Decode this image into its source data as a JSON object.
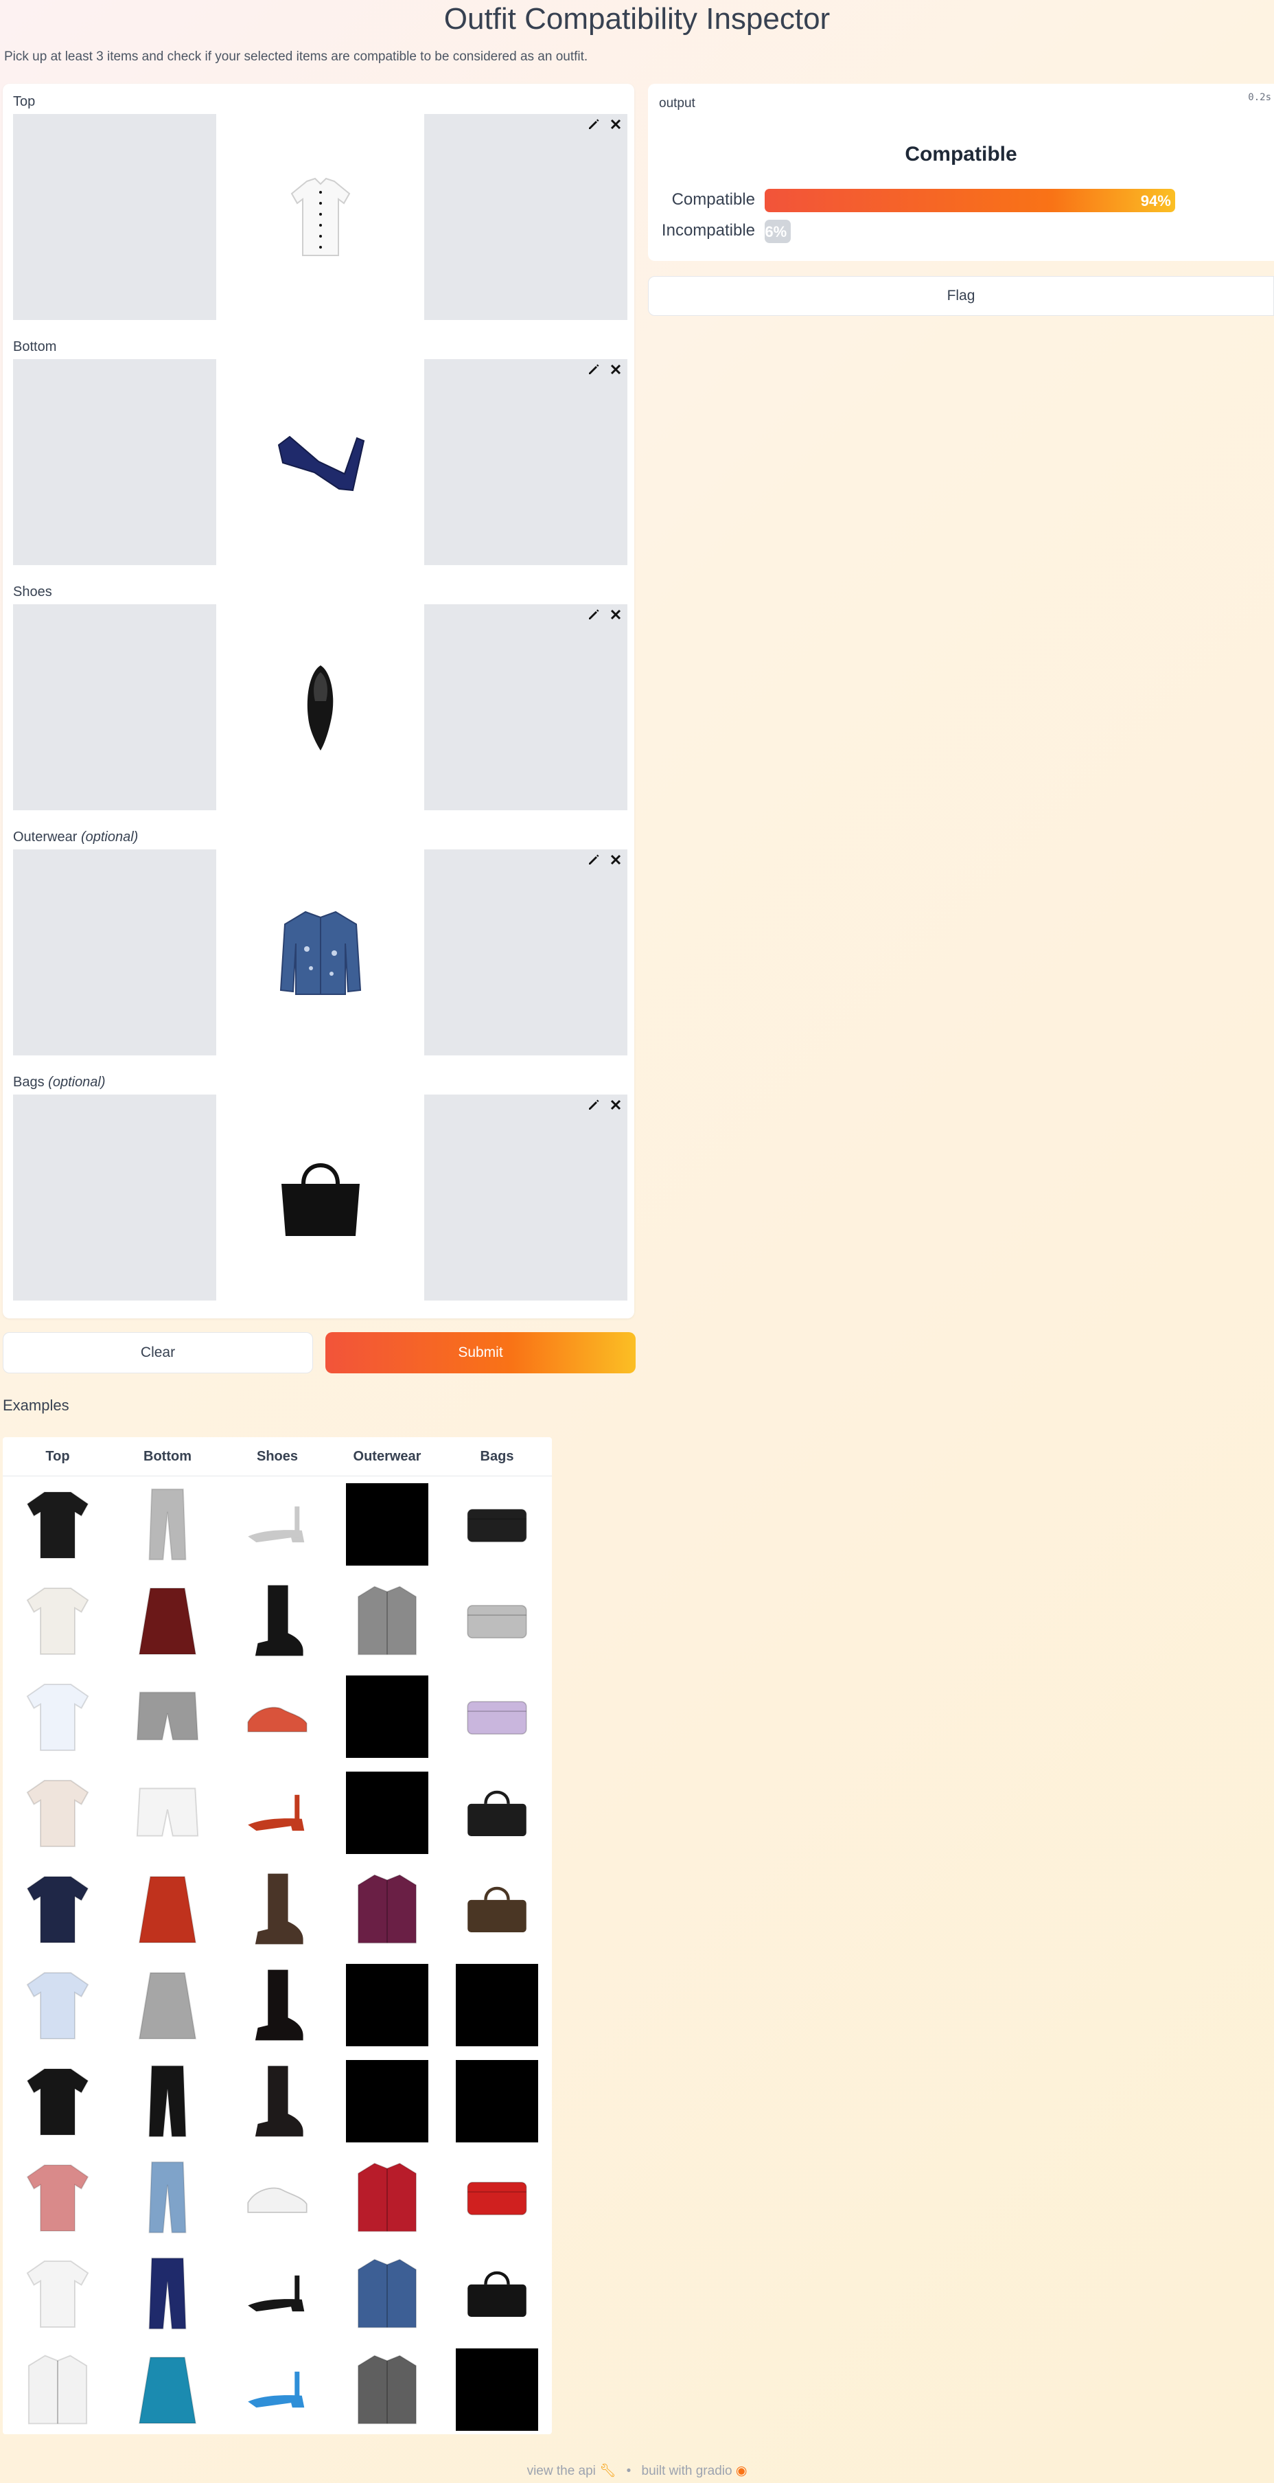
{
  "page": {
    "title": "Outfit Compatibility Inspector",
    "subtitle": "Pick up at least 3 items and check if your selected items are compatible to be considered as an outfit."
  },
  "inputs": [
    {
      "label": "Top",
      "optional": "",
      "item": "top-white-shirt-icon"
    },
    {
      "label": "Bottom",
      "optional": "",
      "item": "bottom-navy-jeans-icon"
    },
    {
      "label": "Shoes",
      "optional": "",
      "item": "shoes-black-pump-icon"
    },
    {
      "label": "Outerwear",
      "optional": "(optional)",
      "item": "outerwear-denim-jacket-icon"
    },
    {
      "label": "Bags",
      "optional": "(optional)",
      "item": "bag-black-tote-icon"
    }
  ],
  "buttons": {
    "clear": "Clear",
    "submit": "Submit",
    "flag": "Flag"
  },
  "output": {
    "label": "output",
    "timer": "0.2s",
    "result": "Compatible",
    "confidences": [
      {
        "label": "Compatible",
        "value": 0.94,
        "pct": "94%"
      },
      {
        "label": "Incompatible",
        "value": 0.06,
        "pct": "6%"
      }
    ]
  },
  "examples": {
    "heading": "Examples",
    "columns": [
      "Top",
      "Bottom",
      "Shoes",
      "Outerwear",
      "Bags"
    ],
    "rows": [
      [
        "black-vneck-top",
        "grey-patterned-trousers",
        "silver-block-heel-sandal",
        "black-empty",
        "black-studded-clutch"
      ],
      [
        "white-checked-blouse",
        "red-floral-mini-skirt",
        "black-laceup-bootie",
        "grey-long-cardigan",
        "silver-bah-humbug-pouch"
      ],
      [
        "blue-offshoulder-top",
        "grey-track-shorts",
        "colorful-sneaker",
        "black-empty",
        "lilac-animal-clutch"
      ],
      [
        "white-lace-cami",
        "white-wide-shorts",
        "red-sandals",
        "black-empty",
        "black-structured-bag"
      ],
      [
        "navy-striped-sweater",
        "red-mini-skirt",
        "brown-riding-boot",
        "plum-blazer",
        "brown-croc-tote"
      ],
      [
        "light-blue-shirt",
        "grey-pencil-skirt",
        "black-platform-bootie",
        "black-empty",
        "black-empty"
      ],
      [
        "black-graphic-tee",
        "black-ripped-jeans",
        "black-buckle-bootie",
        "black-empty",
        "black-empty"
      ],
      [
        "pink-tank-top",
        "light-blue-jeans",
        "white-sneaker",
        "red-leather-jacket",
        "red-zip-pouch"
      ],
      [
        "white-shirt",
        "navy-jeans",
        "black-pump",
        "denim-jacket",
        "black-tote"
      ],
      [
        "white-trimmed-jacket",
        "teal-skirt",
        "blue-strappy-heel",
        "grey-belted-coat",
        "black-empty"
      ]
    ]
  },
  "footer": {
    "api": "view the api",
    "separator": "•",
    "built": "built with gradio"
  },
  "colors": {
    "accent_start": "#f2543a",
    "accent_end": "#fbbf24",
    "slot_grey": "#e5e7eb",
    "background": "#fdf1d6"
  }
}
